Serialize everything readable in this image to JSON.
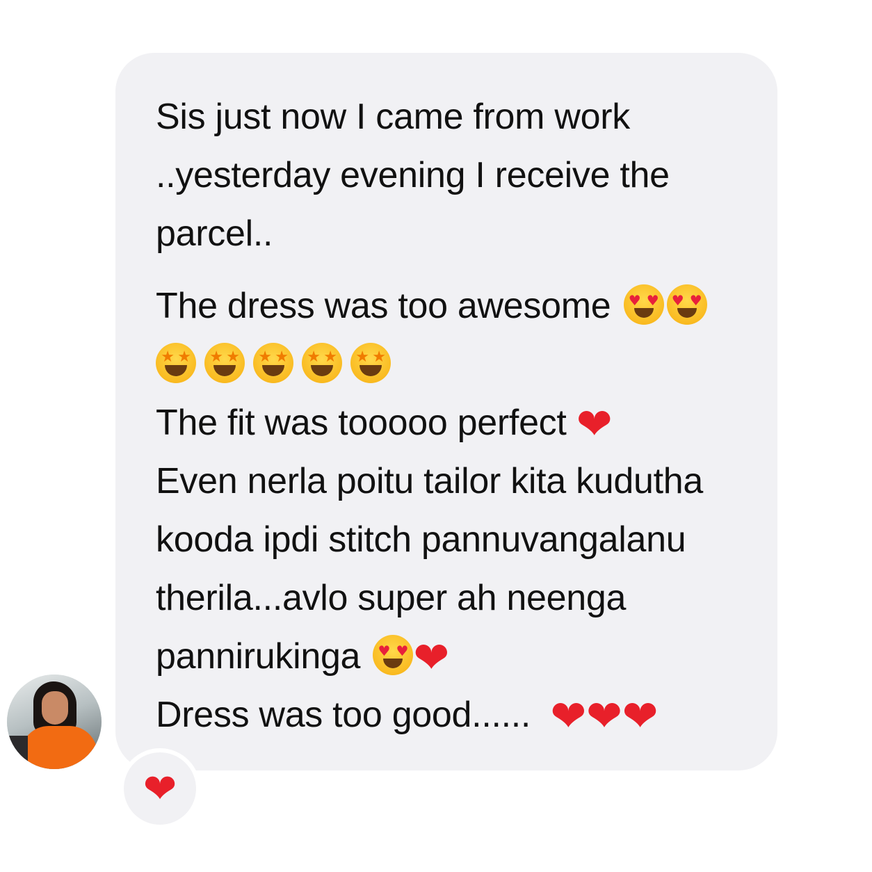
{
  "message": {
    "paragraph1": {
      "line1": "Sis just now I came from work",
      "line2": "..yesterday evening I receive the",
      "line3": "parcel.."
    },
    "paragraph2": {
      "line1": "The dress was too awesome",
      "line3": "The fit was tooooo perfect",
      "line4": "Even nerla poitu tailor kita kudutha",
      "line5": "kooda ipdi stitch pannuvangalanu",
      "line6": "therila...avlo super ah neenga",
      "line7": "pannirukinga",
      "line8": "Dress was too good......"
    }
  },
  "icons": {
    "heart": "❤",
    "star": "★",
    "heart_small": "♥"
  },
  "reaction": {
    "emoji": "❤"
  },
  "colors": {
    "bubble": "#f1f1f4",
    "text": "#111111",
    "heart": "#e8202a",
    "emoji_face": "#f9b91f"
  }
}
